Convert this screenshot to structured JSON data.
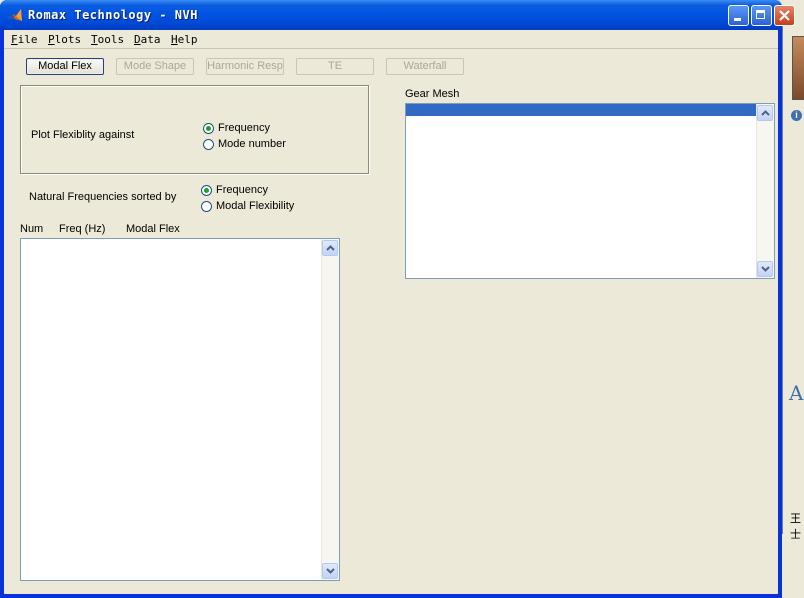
{
  "window": {
    "title": "Romax Technology - NVH",
    "icon": "matlab-icon",
    "controls": {
      "minimize": "minimize-icon",
      "maximize": "maximize-icon",
      "close": "close-icon"
    }
  },
  "menu": {
    "items": [
      "File",
      "Plots",
      "Tools",
      "Data",
      "Help"
    ]
  },
  "toolbar": {
    "buttons": [
      {
        "label": "Modal Flex",
        "enabled": true
      },
      {
        "label": "Mode Shape",
        "enabled": false
      },
      {
        "label": "Harmonic Resp",
        "enabled": false
      },
      {
        "label": "TE",
        "enabled": false
      },
      {
        "label": "Waterfall",
        "enabled": false
      }
    ]
  },
  "plot_flex": {
    "label": "Plot Flexiblity against",
    "options": [
      "Frequency",
      "Mode number"
    ],
    "selected": "Frequency"
  },
  "sort": {
    "label": "Natural Frequencies sorted by",
    "options": [
      "Frequency",
      "Modal Flexibility"
    ],
    "selected": "Frequency"
  },
  "freq_table": {
    "headers": [
      "Num",
      "Freq (Hz)",
      "Modal Flex"
    ]
  },
  "gear_mesh": {
    "label": "Gear Mesh"
  },
  "background_window": {
    "letter": "A",
    "text": "王士"
  },
  "colors": {
    "title_bar": "#0054e3",
    "face": "#ece9d8",
    "selection": "#316ac5"
  }
}
